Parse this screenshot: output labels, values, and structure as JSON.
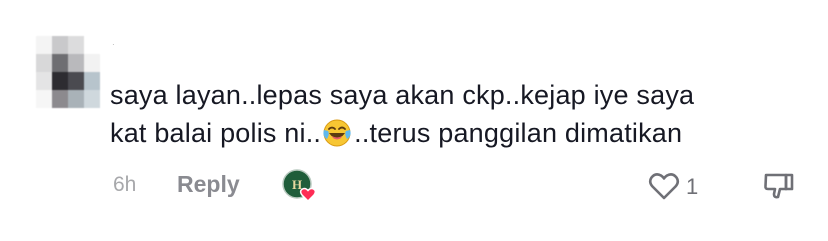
{
  "comment": {
    "text_line_1": "saya layan..lepas saya akan ckp..kejap iye saya",
    "text_line_2_before_emoji": "kat balai polis ni..",
    "text_line_2_after_emoji": "..terus panggilan dimatikan",
    "emoji_icon": "face-with-tears-of-joy-icon",
    "username": "·"
  },
  "meta": {
    "timestamp": "6h",
    "reply_label": "Reply",
    "like_count": "1",
    "creator_badge_icon": "creator-liked-heart-icon",
    "like_icon": "heart-outline-icon",
    "dislike_icon": "thumbs-down-icon"
  },
  "colors": {
    "text": "#161823",
    "muted": "#a7a8ab",
    "reply": "#8a8b91",
    "heart_pink": "#fe2c55",
    "badge_green": "#1f5d3a"
  }
}
